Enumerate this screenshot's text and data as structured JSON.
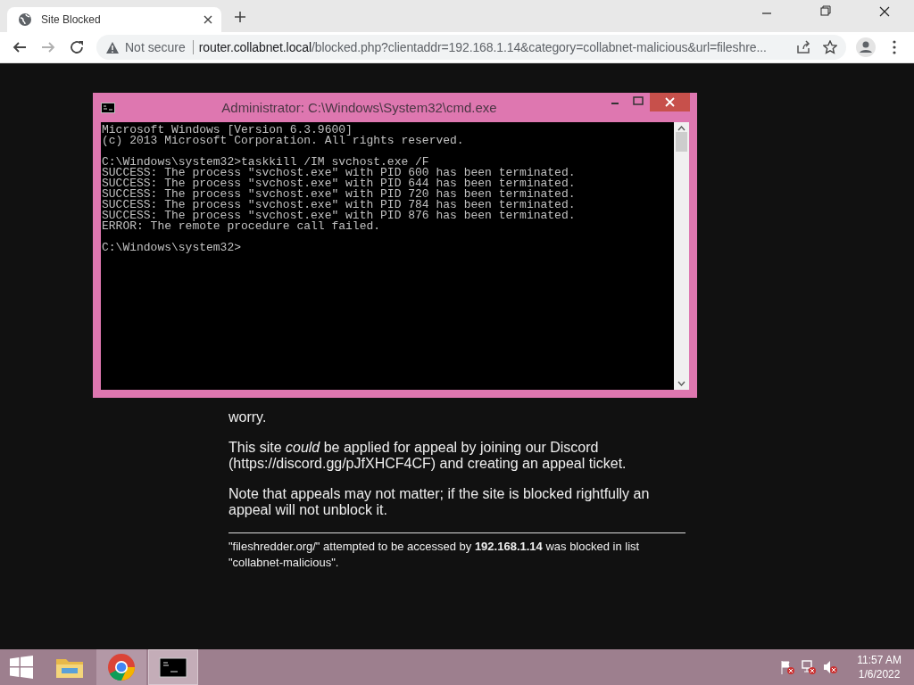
{
  "browser": {
    "tabs": [
      {
        "title": "Site Blocked",
        "selected": true
      }
    ],
    "nav_buttons": [
      {
        "kind": "back",
        "disabled": false
      },
      {
        "kind": "forward",
        "disabled": true
      },
      {
        "kind": "reload",
        "disabled": false
      }
    ],
    "security": {
      "label": "Not secure"
    },
    "address": {
      "host": "router.collabnet.local",
      "rest": "/blocked.php?clientaddr=192.168.1.14&category=collabnet-malicious&url=fileshre..."
    }
  },
  "page": {
    "paragraphs": [
      "worry.",
      "This site *could* be applied for appeal by joining our Discord (https://discord.gg/pJfXHCF4CF) and creating an appeal ticket.",
      "Note that appeals may not matter; if the site is blocked rightfully an appeal will not unblock it."
    ],
    "footer": "\"fileshredder.org/\" attempted to be accessed by **192.168.1.14** was blocked in list \"collabnet-malicious\"."
  },
  "console_window": {
    "title": "Administrator: C:\\Windows\\System32\\cmd.exe",
    "blocks": [
      [
        "Microsoft Windows [Version 6.3.9600]",
        "(c) 2013 Microsoft Corporation. All rights reserved."
      ],
      [
        "C:\\Windows\\system32>taskkill /IM svchost.exe /F",
        "SUCCESS: The process \"svchost.exe\" with PID 600 has been terminated.",
        "SUCCESS: The process \"svchost.exe\" with PID 644 has been terminated.",
        "SUCCESS: The process \"svchost.exe\" with PID 720 has been terminated.",
        "SUCCESS: The process \"svchost.exe\" with PID 784 has been terminated.",
        "SUCCESS: The process \"svchost.exe\" with PID 876 has been terminated.",
        "ERROR: The remote procedure call failed."
      ],
      [
        "C:\\Windows\\system32>"
      ]
    ]
  },
  "taskbar": {
    "apps": [
      {
        "kind": "folder",
        "running": false,
        "selected": false
      },
      {
        "kind": "browser",
        "running": true,
        "selected": false
      },
      {
        "kind": "console",
        "running": true,
        "selected": true
      }
    ],
    "clock": {
      "time": "11:57 AM",
      "date": "1/6/2022"
    }
  }
}
